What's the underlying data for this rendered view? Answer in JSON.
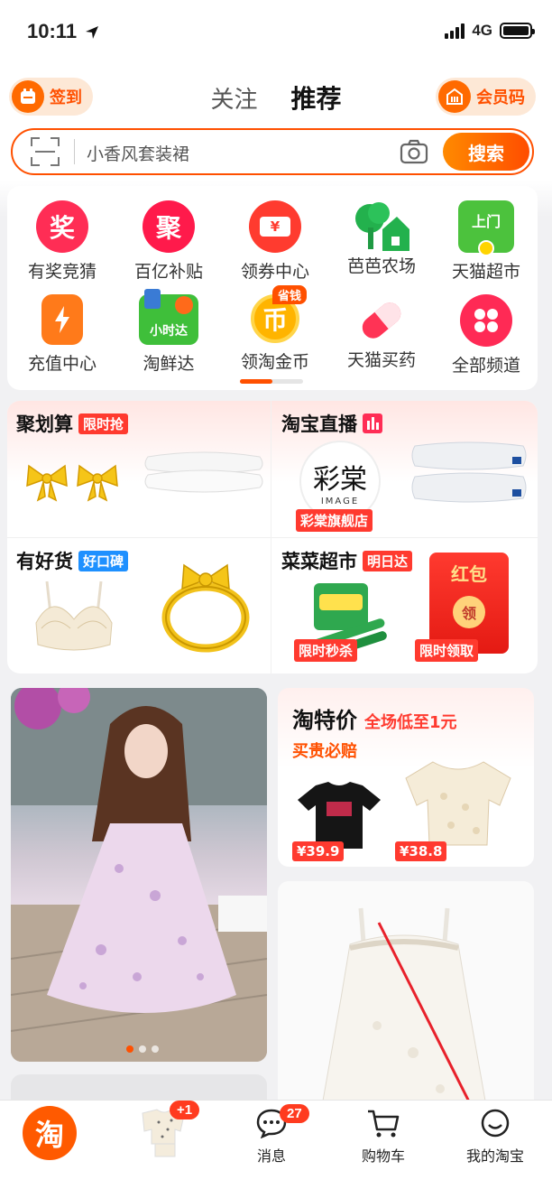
{
  "status_bar": {
    "time": "10:11",
    "network": "4G"
  },
  "header": {
    "signin_label": "签到",
    "tabs": [
      {
        "label": "关注"
      },
      {
        "label": "推荐"
      }
    ],
    "member_code_label": "会员码"
  },
  "search": {
    "placeholder": "小香风套装裙",
    "button_label": "搜索"
  },
  "channels": [
    {
      "icon": "奖",
      "label": "有奖竞猜",
      "color": "#ff2d55"
    },
    {
      "icon": "聚",
      "label": "百亿补贴",
      "color": "#ff1a4b"
    },
    {
      "icon": "¥",
      "label": "领券中心",
      "color": "#ff3b2f"
    },
    {
      "icon": "tree-house-icon",
      "label": "芭芭农场",
      "color": "#23b14d"
    },
    {
      "icon": "上门",
      "label": "天猫超市",
      "color": "#4cc23d"
    },
    {
      "icon": "lightning-icon",
      "label": "充值中心",
      "color": "#ff7a1a"
    },
    {
      "icon": "小时达",
      "label": "淘鲜达",
      "color": "#3fbf3a"
    },
    {
      "icon": "币",
      "label": "领淘金币",
      "color": "#ffb400",
      "tag": "省钱"
    },
    {
      "icon": "pill-icon",
      "label": "天猫买药",
      "color": "#ff3355"
    },
    {
      "icon": "grid-dots-icon",
      "label": "全部频道",
      "color": "#ff2a55"
    }
  ],
  "promos": {
    "juhuasuan": {
      "title": "聚划算",
      "badge": "限时抢"
    },
    "live": {
      "title": "淘宝直播",
      "shop_tag": "彩棠旗舰店",
      "logo_text": "IMAGE"
    },
    "haohuo": {
      "title": "有好货",
      "badge": "好口碑"
    },
    "caicai": {
      "title": "菜菜超市",
      "badge": "明日达",
      "tag_flash": "限时秒杀",
      "tag_redpacket": "限时领取",
      "redpacket_title": "红包",
      "redpacket_btn": "领"
    }
  },
  "taote": {
    "title": "淘特价",
    "subtitle": "全场低至1元",
    "slogan": "买贵必赔",
    "prices": [
      "¥39.9",
      "¥38.8"
    ]
  },
  "tabbar": {
    "home_icon": "淘",
    "cart_badge": "+1",
    "messages": {
      "label": "消息",
      "badge": "27"
    },
    "cart": {
      "label": "购物车"
    },
    "mine": {
      "label": "我的淘宝"
    }
  },
  "colors": {
    "accent": "#ff5000",
    "badge_red": "#ff3a2f"
  }
}
